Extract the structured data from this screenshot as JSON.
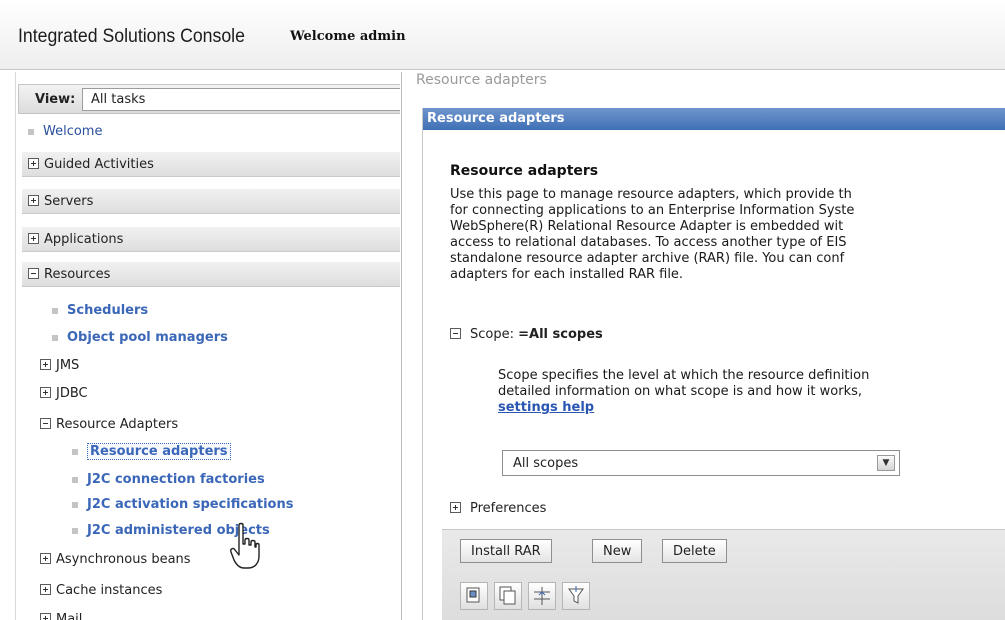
{
  "header": {
    "app_title": "Integrated Solutions Console",
    "welcome_text": "Welcome admin"
  },
  "nav": {
    "view_label": "View:",
    "view_value": "All tasks",
    "welcome_link": "Welcome",
    "sections": {
      "guided": "Guided Activities",
      "servers": "Servers",
      "applications": "Applications",
      "resources": "Resources"
    },
    "resources_items": {
      "schedulers": "Schedulers",
      "object_pool": "Object pool managers",
      "jms": "JMS",
      "jdbc": "JDBC",
      "resource_adapters": "Resource Adapters",
      "ra_links": {
        "resource_adapters": "Resource adapters",
        "j2c_cf": "J2C connection factories",
        "j2c_as": "J2C activation specifications",
        "j2c_ao": "J2C administered objects"
      },
      "async_beans": "Asynchronous beans",
      "cache": "Cache instances",
      "mail": "Mail"
    }
  },
  "content": {
    "breadcrumb": "Resource adapters",
    "panel_title": "Resource adapters",
    "heading": "Resource adapters",
    "description_lines": [
      "Use this page to manage resource adapters, which provide th",
      "for connecting applications to an Enterprise Information Syste",
      "WebSphere(R) Relational Resource Adapter is embedded wit",
      "access to relational databases. To access another type of EIS",
      "standalone resource adapter archive (RAR) file. You can conf",
      "adapters for each installed RAR file."
    ],
    "scope_label": "Scope:",
    "scope_value": "=All scopes",
    "scope_desc_lines": [
      "Scope specifies the level at which the resource definition",
      "detailed information on what scope is and how it works,"
    ],
    "settings_help_link": "settings help",
    "scope_select_value": "All scopes",
    "preferences_label": "Preferences",
    "buttons": {
      "install": "Install RAR",
      "new": "New",
      "delete": "Delete"
    }
  },
  "icons": {
    "view_dropdown": "chevron-down-icon",
    "select_all": "select-all-icon",
    "deselect_all": "deselect-all-icon",
    "filter": "filter-icon",
    "edit_filter": "edit-filter-icon",
    "cursor": "hand-pointer-icon"
  }
}
